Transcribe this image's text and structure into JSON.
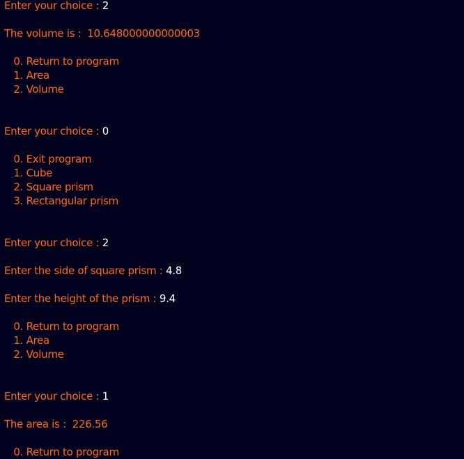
{
  "console": {
    "lines": [
      {
        "prompt": "Enter your choice : ",
        "input": "2"
      },
      {
        "prompt": "",
        "input": ""
      },
      {
        "prompt": "The volume is :  ",
        "input": "10.648000000000003",
        "input_color": "output"
      },
      {
        "prompt": "",
        "input": ""
      },
      {
        "prompt": "   0. Return to program",
        "input": ""
      },
      {
        "prompt": "   1. Area",
        "input": ""
      },
      {
        "prompt": "   2. Volume",
        "input": ""
      },
      {
        "prompt": "",
        "input": ""
      },
      {
        "prompt": "",
        "input": ""
      },
      {
        "prompt": "Enter your choice : ",
        "input": "0"
      },
      {
        "prompt": "",
        "input": ""
      },
      {
        "prompt": "   0. Exit program",
        "input": ""
      },
      {
        "prompt": "   1. Cube",
        "input": ""
      },
      {
        "prompt": "   2. Square prism",
        "input": ""
      },
      {
        "prompt": "   3. Rectangular prism",
        "input": ""
      },
      {
        "prompt": "",
        "input": ""
      },
      {
        "prompt": "",
        "input": ""
      },
      {
        "prompt": "Enter your choice : ",
        "input": "2"
      },
      {
        "prompt": "",
        "input": ""
      },
      {
        "prompt": "Enter the side of square prism : ",
        "input": "4.8"
      },
      {
        "prompt": "",
        "input": ""
      },
      {
        "prompt": "Enter the height of the prism : ",
        "input": "9.4"
      },
      {
        "prompt": "",
        "input": ""
      },
      {
        "prompt": "   0. Return to program",
        "input": ""
      },
      {
        "prompt": "   1. Area",
        "input": ""
      },
      {
        "prompt": "   2. Volume",
        "input": ""
      },
      {
        "prompt": "",
        "input": ""
      },
      {
        "prompt": "",
        "input": ""
      },
      {
        "prompt": "Enter your choice : ",
        "input": "1"
      },
      {
        "prompt": "",
        "input": ""
      },
      {
        "prompt": "The area is :  ",
        "input": "226.56",
        "input_color": "output"
      },
      {
        "prompt": "",
        "input": ""
      },
      {
        "prompt": "   0. Return to program",
        "input": ""
      }
    ]
  },
  "colors": {
    "background": "#02021f",
    "output_text": "#ff6a1a",
    "user_input": "#ffffff"
  }
}
